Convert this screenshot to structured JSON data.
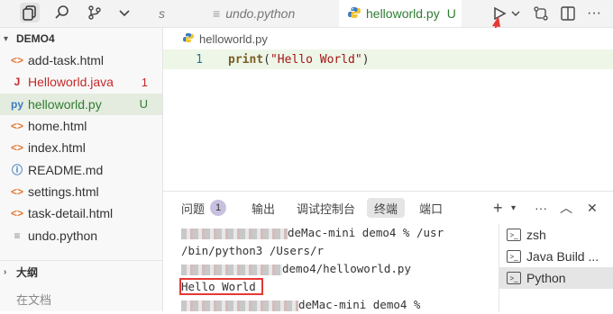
{
  "tabs": {
    "partial": "s",
    "undo": "undo.python",
    "active": "helloworld.py",
    "active_badge": "U",
    "close": "×"
  },
  "explorer": {
    "section": "DEMO4",
    "files": [
      {
        "name": "add-task.html",
        "icon": "<>",
        "iconColor": "#e37933",
        "color": "#333",
        "right": ""
      },
      {
        "name": "Helloworld.java",
        "icon": "J",
        "iconColor": "#c62828",
        "color": "#c62828",
        "right": "1"
      },
      {
        "name": "helloworld.py",
        "icon": "py",
        "iconColor": "#3b7bbf",
        "color": "#2e7d32",
        "right": "U"
      },
      {
        "name": "home.html",
        "icon": "<>",
        "iconColor": "#e37933",
        "color": "#333",
        "right": ""
      },
      {
        "name": "index.html",
        "icon": "<>",
        "iconColor": "#e37933",
        "color": "#333",
        "right": ""
      },
      {
        "name": "README.md",
        "icon": "ⓘ",
        "iconColor": "#3b7bbf",
        "color": "#333",
        "right": ""
      },
      {
        "name": "settings.html",
        "icon": "<>",
        "iconColor": "#e37933",
        "color": "#333",
        "right": ""
      },
      {
        "name": "task-detail.html",
        "icon": "<>",
        "iconColor": "#e37933",
        "color": "#333",
        "right": ""
      },
      {
        "name": "undo.python",
        "icon": "≡",
        "iconColor": "#888",
        "color": "#333",
        "right": ""
      }
    ],
    "outline_title": "大纲",
    "outline_empty": "在文档"
  },
  "editor": {
    "breadcrumb": "helloworld.py",
    "line_no": "1",
    "code_fn": "print",
    "code_open": "(",
    "code_str": "\"Hello World\"",
    "code_close": ")"
  },
  "panel": {
    "tabs": [
      "问题",
      "输出",
      "调试控制台",
      "终端",
      "端口"
    ],
    "problems_count": "1",
    "terminal": {
      "l1_mid": "deMac-mini demo4 % /usr",
      "l2": "/bin/python3 /Users/r",
      "l3_mid": "demo4/helloworld.py",
      "output": "Hello World",
      "l5_mid": "deMac-mini demo4 %"
    },
    "terminals": [
      "zsh",
      "Java Build ...",
      "Python"
    ]
  }
}
